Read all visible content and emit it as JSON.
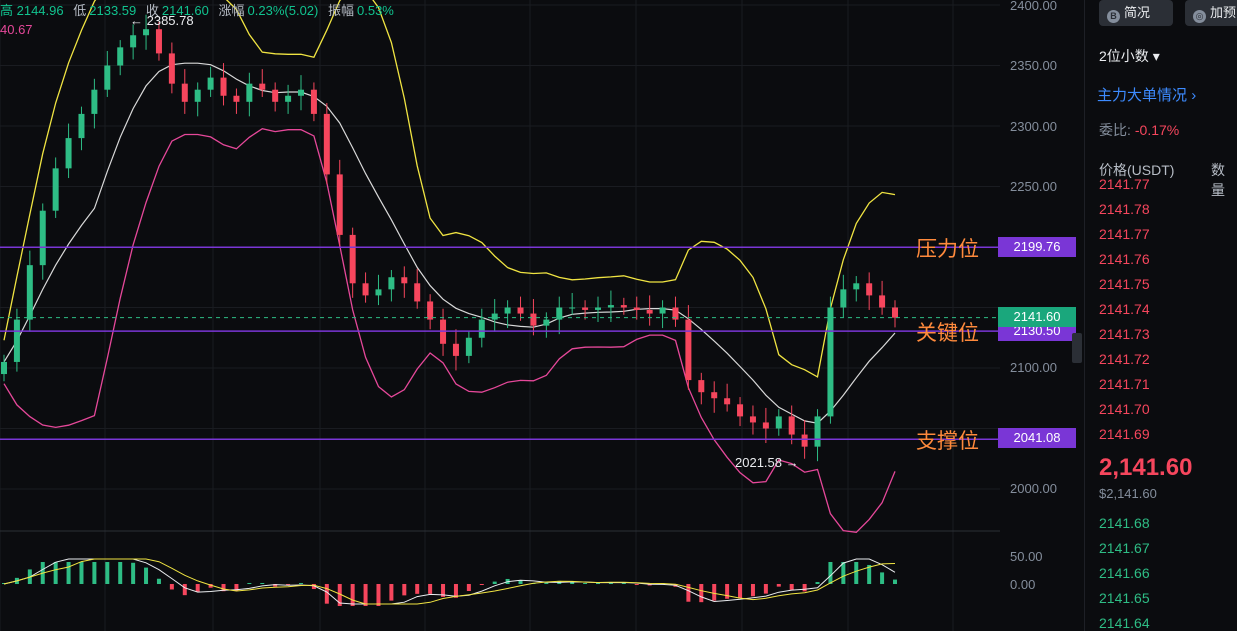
{
  "header": {
    "high": "高 2144.96",
    "low_label": "低",
    "low": "2133.59",
    "close_label": "收",
    "close": "2141.60",
    "change_label": "涨幅",
    "change": "0.23%(5.02)",
    "amplitude_label": "振幅",
    "amplitude": "0.53%",
    "ma_value": "40.67"
  },
  "y_axis": [
    "2400.00",
    "2350.00",
    "2300.00",
    "2250.00",
    "2200.00",
    "2150.00",
    "2100.00",
    "2050.00",
    "2000.00"
  ],
  "macd_axis": [
    "50.00",
    "0.00"
  ],
  "levels": {
    "resistance": {
      "label": "压力位",
      "price": "2199.76"
    },
    "key": {
      "label": "关键位",
      "price": "2130.50"
    },
    "support": {
      "label": "支撑位",
      "price": "2041.08"
    }
  },
  "current_price_tag": "2141.60",
  "markers": {
    "high": "← 2385.78",
    "low": "2021.58 →"
  },
  "colors": {
    "up": "#2ebd85",
    "down": "#f6465d",
    "boll_upper": "#f0e442",
    "boll_mid": "#d9d9d9",
    "boll_lower": "#e6489a",
    "level_line": "#7a36d6",
    "level_text": "#ff8a3c"
  },
  "panel": {
    "btn_simple": "简况",
    "btn_add": "加预",
    "decimals": "2位小数",
    "big_orders": "主力大单情况",
    "ratio_label": "委比:",
    "ratio_value": "-0.17%",
    "col_price": "价格(USDT)",
    "col_qty": "数量",
    "asks": [
      "2141.77",
      "2141.78",
      "2141.77",
      "2141.76",
      "2141.75",
      "2141.74",
      "2141.73",
      "2141.72",
      "2141.71",
      "2141.70",
      "2141.69"
    ],
    "mid_price": "2,141.60",
    "mid_usd": "$2,141.60",
    "bids": [
      "2141.68",
      "2141.67",
      "2141.66",
      "2141.65",
      "2141.64"
    ]
  },
  "chart_data": {
    "type": "candlestick",
    "symbol_hint": "ETH/USDT",
    "price_range": [
      1970,
      2410
    ],
    "closes": [
      2105,
      2140,
      2185,
      2230,
      2265,
      2290,
      2310,
      2330,
      2350,
      2365,
      2375,
      2380,
      2360,
      2335,
      2320,
      2330,
      2340,
      2325,
      2320,
      2335,
      2330,
      2320,
      2325,
      2330,
      2310,
      2260,
      2210,
      2170,
      2160,
      2165,
      2175,
      2170,
      2155,
      2140,
      2120,
      2110,
      2125,
      2140,
      2145,
      2150,
      2145,
      2135,
      2140,
      2150,
      2150,
      2148,
      2150,
      2152,
      2150,
      2148,
      2145,
      2150,
      2140,
      2090,
      2080,
      2075,
      2070,
      2060,
      2055,
      2050,
      2060,
      2045,
      2035,
      2060,
      2150,
      2165,
      2170,
      2160,
      2150,
      2141.6
    ],
    "boll_upper": "yellow band line",
    "boll_mid": "white middle line",
    "boll_lower": "magenta band line"
  }
}
